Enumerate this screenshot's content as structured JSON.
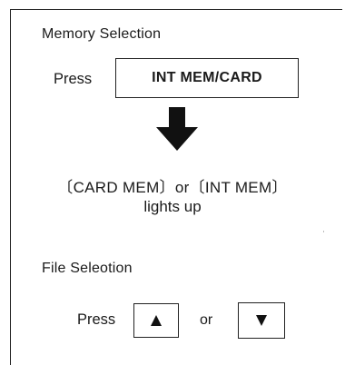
{
  "memory_section": {
    "title": "Memory Selection",
    "press_label": "Press",
    "key_label": "INT MEM/CARD",
    "result_line1": "〔CARD MEM〕or〔INT MEM〕",
    "result_line2": "lights up"
  },
  "file_section": {
    "title": "File Seleotion",
    "press_label": "Press",
    "or_label": "or",
    "up_key_icon": "triangle-up-icon",
    "down_key_icon": "triangle-down-icon"
  },
  "icons": {
    "arrow": "arrow-down-icon"
  },
  "colors": {
    "ink": "#1a1a1a",
    "background": "#ffffff"
  }
}
